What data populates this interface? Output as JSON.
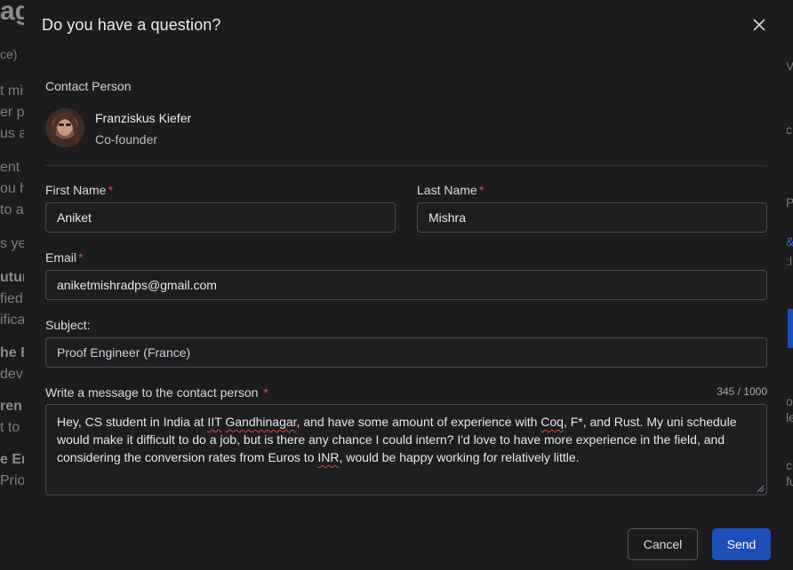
{
  "background": {
    "left_fragments": [
      "agi",
      "ce)",
      "t mis",
      "er pl",
      "us ac",
      "ent in",
      "ou h",
      "to ap",
      "s ye",
      "utur",
      "fied",
      "ifica",
      "he B",
      "dev",
      "ren",
      "t to",
      "e En",
      "Prio"
    ],
    "right_fragments": [
      "V",
      "c",
      "P",
      "&",
      ":l",
      "ou",
      "le",
      "cla",
      "fu"
    ]
  },
  "modal": {
    "title": "Do you have a question?",
    "close_icon": "close-icon",
    "contact_section_label": "Contact Person",
    "contact": {
      "name": "Franziskus Kiefer",
      "role": "Co-founder"
    },
    "fields": {
      "first_name": {
        "label": "First Name",
        "required_marker": "*",
        "value": "Aniket"
      },
      "last_name": {
        "label": "Last Name",
        "required_marker": "*",
        "value": "Mishra"
      },
      "email": {
        "label": "Email",
        "required_marker": "*",
        "value": "aniketmishradps@gmail.com"
      },
      "subject": {
        "label": "Subject:",
        "value": "Proof Engineer (France)"
      },
      "message": {
        "label": "Write a message to the contact person",
        "required_marker": "*",
        "counter": "345 / 1000",
        "parts": [
          "Hey, CS student in India at ",
          "IIT",
          " ",
          "Gandhinagar",
          ", and have some amount of experience with ",
          "Coq",
          ", F*, and Rust. My uni schedule would make it difficult to do a job, but is there any chance I could intern? I'd love to have more experience in the field, and considering the conversion rates from Euros to ",
          "INR",
          ", would be happy working for relatively little."
        ]
      }
    },
    "buttons": {
      "cancel": "Cancel",
      "send": "Send"
    },
    "colors": {
      "accent": "#1d4fb8",
      "required": "#e5484d",
      "modal_bg": "#1c1c1e"
    }
  }
}
